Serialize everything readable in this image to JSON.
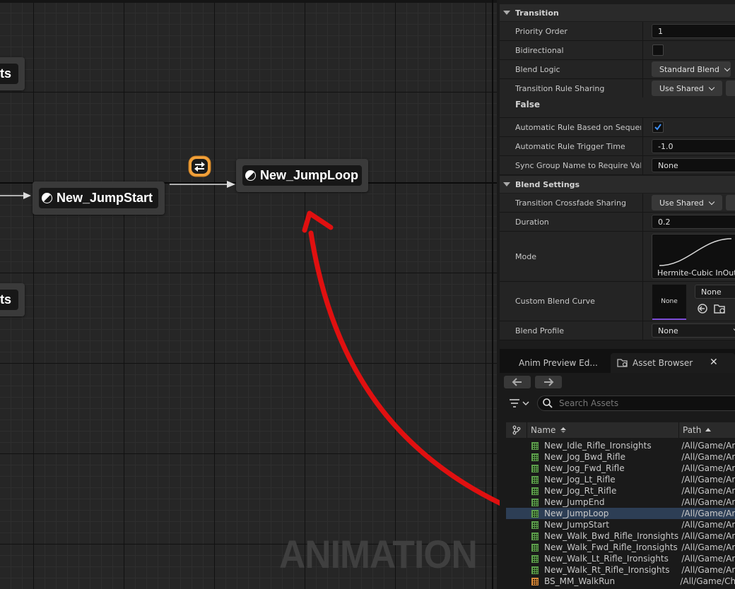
{
  "graph": {
    "nodes": [
      {
        "id": "left-top",
        "label": "ts"
      },
      {
        "id": "left-bottom",
        "label": "ts"
      },
      {
        "id": "jumpstart",
        "label": "New_JumpStart"
      },
      {
        "id": "jumploop",
        "label": "New_JumpLoop"
      }
    ],
    "watermark": "ANIMATION",
    "colors": {
      "annotation": "#e01010",
      "transition_icon": "#f2a13a"
    }
  },
  "details": {
    "transition_section": "Transition",
    "priority_order": {
      "label": "Priority Order",
      "value": "1"
    },
    "bidirectional": {
      "label": "Bidirectional",
      "checked": false
    },
    "blend_logic": {
      "label": "Blend Logic",
      "value": "Standard Blend"
    },
    "rule_sharing": {
      "label": "Transition Rule Sharing",
      "value": "Use Shared"
    },
    "false_label": "False",
    "auto_rule": {
      "label": "Automatic Rule Based on Sequen...",
      "checked": true
    },
    "trigger_time": {
      "label": "Automatic Rule Trigger Time",
      "value": "-1.0"
    },
    "sync_group": {
      "label": "Sync Group Name to Require Vali...",
      "value": "None"
    },
    "blend_section": "Blend Settings",
    "crossfade_sharing": {
      "label": "Transition Crossfade Sharing",
      "value": "Use Shared"
    },
    "duration": {
      "label": "Duration",
      "value": "0.2"
    },
    "mode": {
      "label": "Mode",
      "value": "Hermite-Cubic InOut"
    },
    "custom_curve": {
      "label": "Custom Blend Curve",
      "thumb": "None",
      "value": "None"
    },
    "blend_profile": {
      "label": "Blend Profile",
      "value": "None"
    }
  },
  "tabs": [
    {
      "label": "Anim Preview Ed..."
    },
    {
      "label": "Asset Browser"
    }
  ],
  "asset_browser": {
    "search_placeholder": "Search Assets",
    "columns": {
      "name": "Name",
      "path": "Path"
    },
    "assets": [
      {
        "name": "New_Idle_Rifle_Ironsights",
        "path": "/All/Game/Ar",
        "type": "sequence"
      },
      {
        "name": "New_Jog_Bwd_Rifle",
        "path": "/All/Game/Ar",
        "type": "sequence"
      },
      {
        "name": "New_Jog_Fwd_Rifle",
        "path": "/All/Game/Ar",
        "type": "sequence"
      },
      {
        "name": "New_Jog_Lt_Rifle",
        "path": "/All/Game/Ar",
        "type": "sequence"
      },
      {
        "name": "New_Jog_Rt_Rifle",
        "path": "/All/Game/Ar",
        "type": "sequence"
      },
      {
        "name": "New_JumpEnd",
        "path": "/All/Game/Ar",
        "type": "sequence"
      },
      {
        "name": "New_JumpLoop",
        "path": "/All/Game/Ar",
        "type": "sequence",
        "selected": true
      },
      {
        "name": "New_JumpStart",
        "path": "/All/Game/Ar",
        "type": "sequence"
      },
      {
        "name": "New_Walk_Bwd_Rifle_Ironsights",
        "path": "/All/Game/Ar",
        "type": "sequence"
      },
      {
        "name": "New_Walk_Fwd_Rifle_Ironsights",
        "path": "/All/Game/Ar",
        "type": "sequence"
      },
      {
        "name": "New_Walk_Lt_Rifle_Ironsights",
        "path": "/All/Game/Ar",
        "type": "sequence"
      },
      {
        "name": "New_Walk_Rt_Rifle_Ironsights",
        "path": "/All/Game/Ar",
        "type": "sequence"
      },
      {
        "name": "BS_MM_WalkRun",
        "path": "/All/Game/Ch",
        "type": "blendspace"
      }
    ]
  }
}
